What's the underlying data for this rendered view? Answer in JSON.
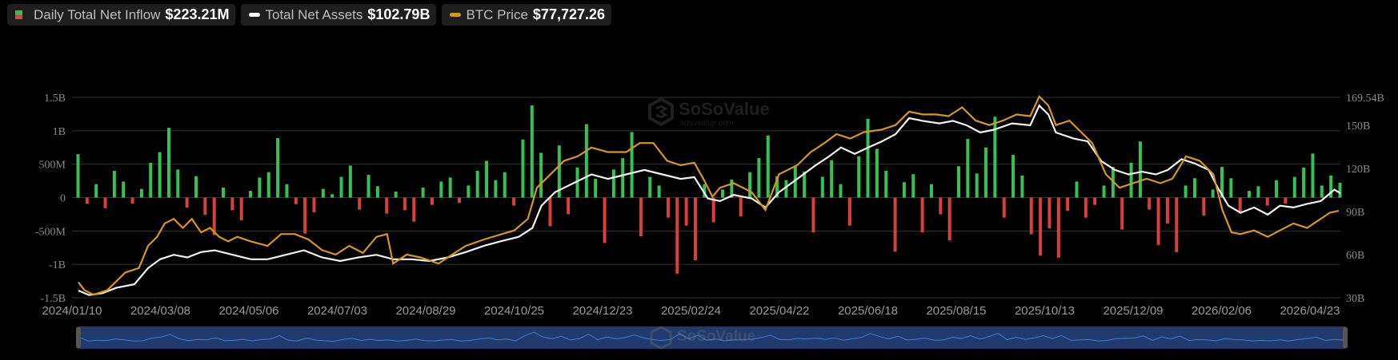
{
  "legend": {
    "flow": {
      "label": "Daily Total Net Inflow",
      "value": "$223.21M"
    },
    "assets": {
      "label": "Total Net Assets",
      "value": "$102.79B"
    },
    "btc": {
      "label": "BTC Price",
      "value": "$77,727.26"
    }
  },
  "watermark": {
    "brand": "SoSoValue",
    "url": "sosovalue.com"
  },
  "colors": {
    "inflow": "#35c253",
    "outflow": "#d9403a",
    "assets": "#ffffff",
    "btc": "#d9961c",
    "grid": "#333333",
    "navigator_fill": "#1f3a6b",
    "navigator_line": "#3f7fd6"
  },
  "chart_data": {
    "type": "bar+line",
    "title": "",
    "x_start": "2024/01/10",
    "x_end": "2026/04/23",
    "x_total_days": 834,
    "x_ticks": [
      "2024/01/10",
      "2024/03/08",
      "2024/05/06",
      "2024/07/03",
      "2024/08/29",
      "2024/10/25",
      "2024/12/23",
      "2025/02/24",
      "2025/04/22",
      "2025/06/18",
      "2025/08/15",
      "2025/10/13",
      "2025/12/09",
      "2026/02/06",
      "2026/04/23"
    ],
    "left_axis": {
      "unit": "USD",
      "ticks": [
        "1.5B",
        "1B",
        "500M",
        "0",
        "-500M",
        "-1B",
        "-1.5B"
      ],
      "range_millions": [
        -1500,
        1500
      ]
    },
    "right_axis": {
      "unit": "USD",
      "ticks": [
        "169.54B",
        "150B",
        "120B",
        "90B",
        "60B",
        "30B"
      ],
      "tick_values": [
        169.54,
        150,
        120,
        90,
        60,
        30
      ],
      "range_billions": [
        30,
        169.54
      ]
    },
    "grid": true,
    "legend_position": "top-left",
    "series": [
      {
        "name": "Daily Total Net Inflow",
        "type": "bar",
        "unit": "USD millions",
        "values": [
          650,
          -95,
          200,
          -160,
          400,
          240,
          -90,
          130,
          520,
          680,
          1045,
          420,
          -150,
          320,
          -260,
          -560,
          150,
          -190,
          -340,
          100,
          300,
          380,
          890,
          200,
          -100,
          -540,
          -220,
          130,
          50,
          310,
          480,
          -180,
          340,
          170,
          -240,
          90,
          -190,
          -360,
          150,
          -110,
          240,
          300,
          -80,
          180,
          400,
          550,
          260,
          380,
          -120,
          870,
          1380,
          670,
          -430,
          780,
          -250,
          450,
          1100,
          280,
          -680,
          420,
          590,
          980,
          -580,
          310,
          180,
          -300,
          -1140,
          -420,
          -940,
          200,
          -370,
          120,
          270,
          -280,
          380,
          590,
          930,
          320,
          260,
          480,
          390,
          -520,
          310,
          560,
          200,
          -420,
          620,
          1180,
          730,
          400,
          -810,
          230,
          350,
          -520,
          200,
          -250,
          -640,
          470,
          880,
          360,
          750,
          1210,
          -300,
          640,
          330,
          -550,
          -870,
          -460,
          -900,
          -200,
          240,
          -300,
          -110,
          180,
          460,
          -480,
          520,
          840,
          -180,
          -710,
          -390,
          -820,
          180,
          290,
          -270,
          120,
          460,
          290,
          -240,
          100,
          170,
          -120,
          260,
          -90,
          310,
          450,
          660,
          180,
          330,
          223.21
        ]
      },
      {
        "name": "Total Net Assets",
        "type": "line",
        "unit": "USD billions",
        "points_day_value": [
          [
            0,
            35.0
          ],
          [
            7,
            31.9
          ],
          [
            16,
            33.2
          ],
          [
            25,
            36.9
          ],
          [
            37,
            39.4
          ],
          [
            46,
            50.6
          ],
          [
            54,
            56.8
          ],
          [
            63,
            59.9
          ],
          [
            72,
            58.1
          ],
          [
            81,
            61.8
          ],
          [
            90,
            63.0
          ],
          [
            102,
            59.9
          ],
          [
            114,
            56.8
          ],
          [
            125,
            56.8
          ],
          [
            137,
            59.9
          ],
          [
            149,
            63.0
          ],
          [
            161,
            58.1
          ],
          [
            173,
            55.6
          ],
          [
            185,
            58.1
          ],
          [
            197,
            59.9
          ],
          [
            208,
            56.8
          ],
          [
            220,
            56.8
          ],
          [
            232,
            55.6
          ],
          [
            244,
            58.1
          ],
          [
            256,
            61.8
          ],
          [
            268,
            66.2
          ],
          [
            279,
            69.3
          ],
          [
            291,
            72.4
          ],
          [
            300,
            78.6
          ],
          [
            306,
            94.1
          ],
          [
            315,
            103.5
          ],
          [
            327,
            109.7
          ],
          [
            339,
            115.9
          ],
          [
            350,
            112.8
          ],
          [
            362,
            115.9
          ],
          [
            374,
            119.0
          ],
          [
            386,
            115.9
          ],
          [
            398,
            112.8
          ],
          [
            407,
            114.0
          ],
          [
            416,
            99.1
          ],
          [
            424,
            97.3
          ],
          [
            433,
            101.6
          ],
          [
            445,
            99.1
          ],
          [
            454,
            92.9
          ],
          [
            463,
            103.5
          ],
          [
            475,
            112.8
          ],
          [
            487,
            122.1
          ],
          [
            496,
            128.4
          ],
          [
            504,
            134.6
          ],
          [
            513,
            130.2
          ],
          [
            522,
            134.6
          ],
          [
            531,
            138.9
          ],
          [
            540,
            143.9
          ],
          [
            549,
            155.1
          ],
          [
            558,
            153.2
          ],
          [
            569,
            151.4
          ],
          [
            578,
            153.2
          ],
          [
            587,
            150.1
          ],
          [
            596,
            145.1
          ],
          [
            605,
            147.0
          ],
          [
            617,
            151.4
          ],
          [
            629,
            150.1
          ],
          [
            635,
            163.8
          ],
          [
            641,
            157.6
          ],
          [
            646,
            145.1
          ],
          [
            658,
            140.8
          ],
          [
            667,
            138.9
          ],
          [
            676,
            125.2
          ],
          [
            685,
            119.0
          ],
          [
            694,
            115.9
          ],
          [
            703,
            117.8
          ],
          [
            712,
            115.9
          ],
          [
            720,
            119.0
          ],
          [
            729,
            126.5
          ],
          [
            738,
            123.4
          ],
          [
            747,
            119.0
          ],
          [
            753,
            106.6
          ],
          [
            760,
            94.1
          ],
          [
            768,
            89.2
          ],
          [
            777,
            92.9
          ],
          [
            786,
            87.9
          ],
          [
            794,
            94.1
          ],
          [
            803,
            92.9
          ],
          [
            812,
            95.4
          ],
          [
            821,
            97.3
          ],
          [
            830,
            105.3
          ],
          [
            834,
            102.79
          ]
        ]
      },
      {
        "name": "BTC Price",
        "type": "line",
        "unit": "USD thousands",
        "points_day_value": [
          [
            0,
            47.5
          ],
          [
            4,
            44.1
          ],
          [
            10,
            42.2
          ],
          [
            19,
            44.1
          ],
          [
            31,
            51.6
          ],
          [
            40,
            53.5
          ],
          [
            46,
            62.9
          ],
          [
            52,
            66.7
          ],
          [
            57,
            72.4
          ],
          [
            63,
            74.3
          ],
          [
            69,
            70.5
          ],
          [
            75,
            74.3
          ],
          [
            81,
            68.6
          ],
          [
            87,
            70.5
          ],
          [
            93,
            66.7
          ],
          [
            99,
            64.8
          ],
          [
            105,
            66.7
          ],
          [
            114,
            64.8
          ],
          [
            125,
            62.9
          ],
          [
            134,
            67.9
          ],
          [
            143,
            67.9
          ],
          [
            152,
            65.6
          ],
          [
            161,
            61.1
          ],
          [
            170,
            59.2
          ],
          [
            179,
            62.9
          ],
          [
            188,
            59.9
          ],
          [
            197,
            66.7
          ],
          [
            204,
            67.9
          ],
          [
            208,
            55.4
          ],
          [
            217,
            59.2
          ],
          [
            226,
            58.0
          ],
          [
            238,
            55.4
          ],
          [
            247,
            59.2
          ],
          [
            256,
            62.9
          ],
          [
            268,
            65.6
          ],
          [
            280,
            67.9
          ],
          [
            288,
            69.4
          ],
          [
            297,
            74.3
          ],
          [
            303,
            87.5
          ],
          [
            312,
            93.2
          ],
          [
            321,
            98.9
          ],
          [
            330,
            100.8
          ],
          [
            339,
            104.5
          ],
          [
            350,
            102.6
          ],
          [
            362,
            102.6
          ],
          [
            371,
            106.4
          ],
          [
            380,
            106.4
          ],
          [
            389,
            98.9
          ],
          [
            398,
            97.0
          ],
          [
            407,
            98.1
          ],
          [
            413,
            91.3
          ],
          [
            419,
            83.7
          ],
          [
            424,
            87.5
          ],
          [
            433,
            89.4
          ],
          [
            445,
            85.6
          ],
          [
            454,
            78.1
          ],
          [
            463,
            93.2
          ],
          [
            475,
            97.0
          ],
          [
            484,
            102.6
          ],
          [
            493,
            106.4
          ],
          [
            501,
            110.2
          ],
          [
            510,
            108.3
          ],
          [
            519,
            111.0
          ],
          [
            531,
            112.1
          ],
          [
            540,
            114.0
          ],
          [
            549,
            119.7
          ],
          [
            558,
            118.5
          ],
          [
            567,
            118.5
          ],
          [
            575,
            117.8
          ],
          [
            584,
            121.5
          ],
          [
            593,
            115.9
          ],
          [
            602,
            114.0
          ],
          [
            611,
            115.9
          ],
          [
            620,
            118.5
          ],
          [
            629,
            117.8
          ],
          [
            635,
            126.1
          ],
          [
            641,
            122.3
          ],
          [
            646,
            114.0
          ],
          [
            655,
            115.9
          ],
          [
            664,
            110.2
          ],
          [
            670,
            106.4
          ],
          [
            679,
            93.2
          ],
          [
            688,
            87.5
          ],
          [
            697,
            89.4
          ],
          [
            706,
            91.3
          ],
          [
            715,
            89.4
          ],
          [
            723,
            91.3
          ],
          [
            732,
            100.8
          ],
          [
            741,
            98.9
          ],
          [
            750,
            93.2
          ],
          [
            756,
            78.1
          ],
          [
            762,
            68.6
          ],
          [
            768,
            67.9
          ],
          [
            777,
            69.4
          ],
          [
            786,
            66.7
          ],
          [
            794,
            69.4
          ],
          [
            803,
            72.4
          ],
          [
            812,
            70.5
          ],
          [
            821,
            74.3
          ],
          [
            827,
            76.9
          ],
          [
            833,
            77.73
          ]
        ]
      }
    ]
  }
}
